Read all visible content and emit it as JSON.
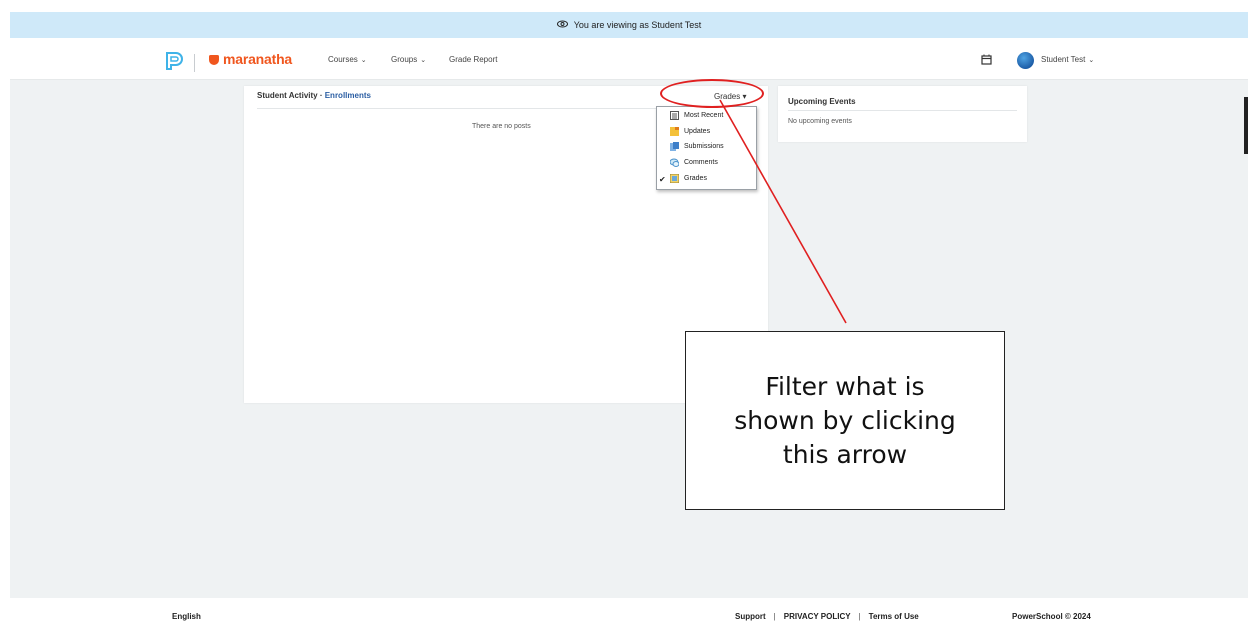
{
  "banner": {
    "text": "You are viewing as Student Test",
    "icon": "eye-icon"
  },
  "nav": {
    "brand": "maranatha",
    "courses": "Courses",
    "groups": "Groups",
    "grade_report": "Grade Report",
    "user_name": "Student Test"
  },
  "activity": {
    "title": "Student Activity",
    "separator": " · ",
    "link": "Enrollments",
    "filter_label": "Grades",
    "empty_text": "There are no posts",
    "filter_options": [
      {
        "label": "Most Recent",
        "icon": "list-icon"
      },
      {
        "label": "Updates",
        "icon": "update-icon"
      },
      {
        "label": "Submissions",
        "icon": "submission-icon"
      },
      {
        "label": "Comments",
        "icon": "comment-icon"
      },
      {
        "label": "Grades",
        "icon": "grades-icon",
        "selected": true
      }
    ]
  },
  "events": {
    "title": "Upcoming Events",
    "empty_text": "No upcoming events"
  },
  "annotation": {
    "callout_text": "Filter what is shown by clicking this arrow",
    "color": "#e02020"
  },
  "footer": {
    "language": "English",
    "support": "Support",
    "privacy": "PRIVACY POLICY",
    "terms": "Terms of Use",
    "separator": "|",
    "copyright": "PowerSchool © 2024"
  },
  "colors": {
    "brand": "#f0561e",
    "banner": "#cfe9f9",
    "link": "#2b5ea3",
    "background": "#eff2f3"
  }
}
